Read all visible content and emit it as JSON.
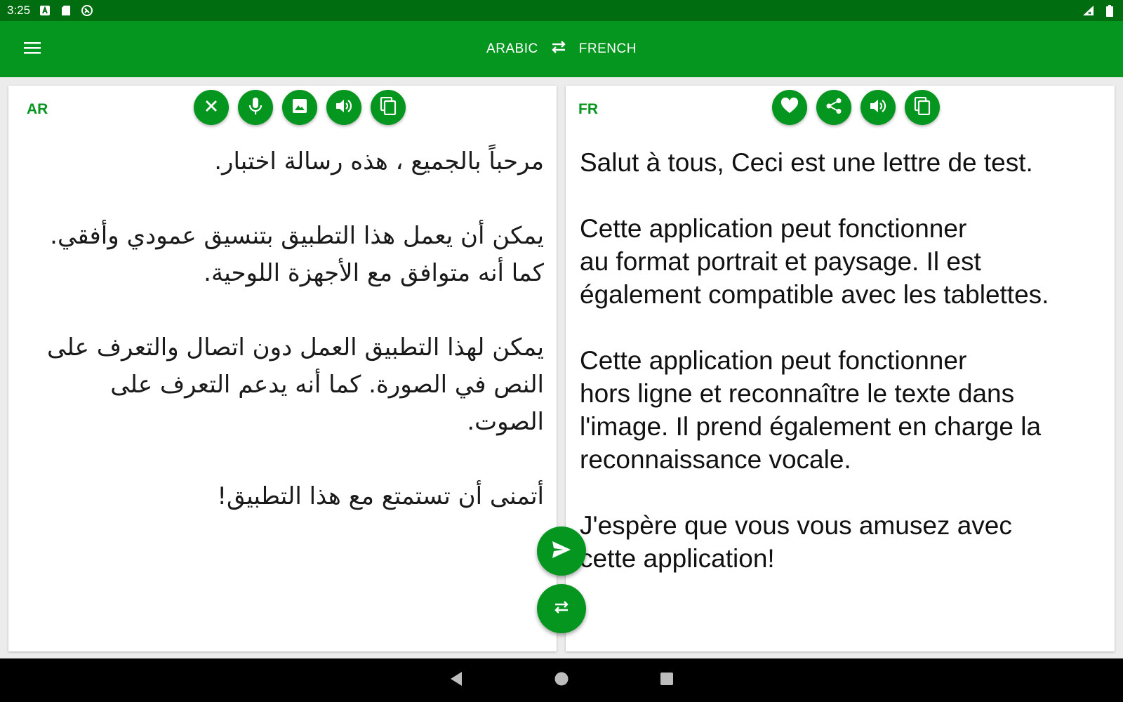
{
  "status_bar": {
    "time": "3:25",
    "left_icons": [
      "a-badge-icon",
      "sd-card-icon",
      "sync-circle-icon"
    ],
    "right_icons": [
      "signal-icon",
      "battery-icon"
    ]
  },
  "app_bar": {
    "source_language": "ARABIC",
    "target_language": "FRENCH",
    "menu_icon": "hamburger-menu-icon",
    "swap_icon": "swap-arrows-icon"
  },
  "source_panel": {
    "code": "AR",
    "buttons": [
      "clear-icon",
      "microphone-icon",
      "image-icon",
      "speaker-icon",
      "copy-icon"
    ],
    "text": "مرحباً بالجميع ، هذه رسالة اختبار.\n\nيمكن أن يعمل هذا التطبيق بتنسيق عمودي وأفقي. كما أنه متوافق مع الأجهزة اللوحية.\n\nيمكن لهذا التطبيق العمل دون اتصال والتعرف على النص في الصورة. كما أنه يدعم التعرف على الصوت.\n\nأتمنى أن تستمتع مع هذا التطبيق!"
  },
  "target_panel": {
    "code": "FR",
    "buttons": [
      "heart-icon",
      "share-icon",
      "speaker-icon",
      "copy-icon"
    ],
    "text": "Salut à tous, Ceci est une lettre de test.\n\nCette application peut fonctionner\nau format portrait et paysage. Il est\négalement compatible avec les tablettes.\n\nCette application peut fonctionner\nhors ligne et reconnaître le texte dans\nl'image. Il prend également en charge la\nreconnaissance vocale.\n\nJ'espère que vous vous amusez avec\ncette application!"
  },
  "fabs": [
    "send-icon",
    "swap-icon"
  ],
  "nav_bar": [
    "back-icon",
    "home-icon",
    "recents-icon"
  ],
  "colors": {
    "status_bar": "#006d10",
    "app_bar": "#05961f",
    "accent": "#05961f",
    "nav_bar": "#000000"
  }
}
